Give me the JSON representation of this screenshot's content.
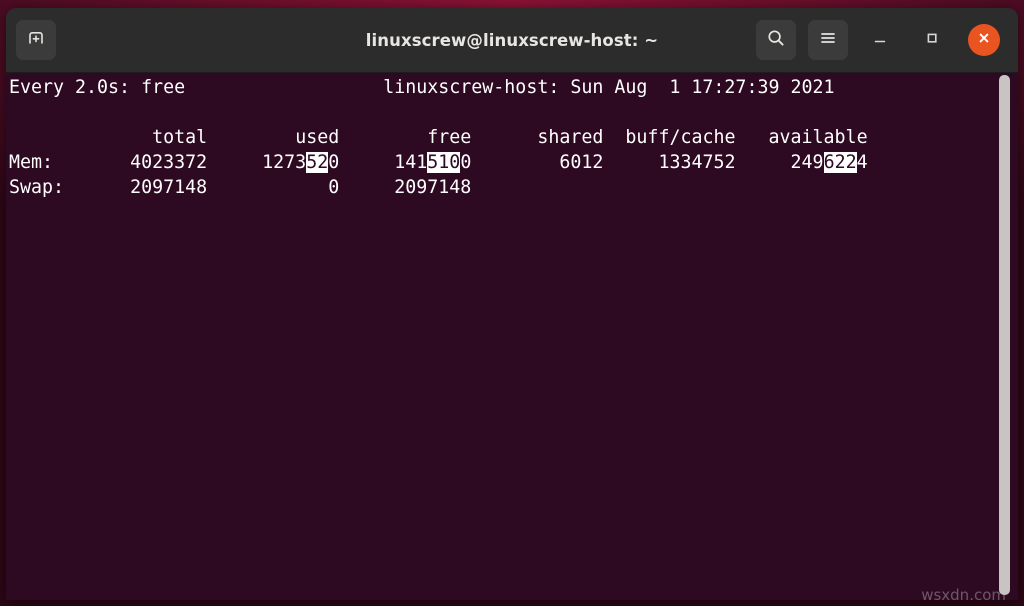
{
  "window": {
    "title": "linuxscrew@linuxscrew-host: ~",
    "new_tab_icon": "new-tab-icon",
    "search_icon": "search-icon",
    "menu_icon": "hamburger-menu-icon",
    "minimize_icon": "minimize-icon",
    "maximize_icon": "maximize-icon",
    "close_icon": "close-icon",
    "colors": {
      "titlebar_bg": "#2c2c2c",
      "terminal_bg": "#2d0922",
      "close_button": "#e95420",
      "text": "#ffffff",
      "scrollbar": "#c8c4c2",
      "desktop": "#6b0f2c"
    }
  },
  "terminal": {
    "watch_header_left": "Every 2.0s: free",
    "watch_header_right": "linuxscrew-host: Sun Aug  1 17:27:39 2021",
    "blank_line": "",
    "columns": [
      "total",
      "used",
      "free",
      "shared",
      "buff/cache",
      "available"
    ],
    "column_header_line": "              total        used        free      shared  buff/cache   available",
    "rows": [
      {
        "label": "Mem:",
        "total": "4023372",
        "used": "1273520",
        "used_plain_prefix": "1273",
        "used_highlight": "52",
        "used_plain_suffix": "0",
        "free": "1415100",
        "free_plain_prefix": "141",
        "free_highlight": "510",
        "free_plain_suffix": "0",
        "shared": "6012",
        "buff_cache": "1334752",
        "available": "2496224",
        "available_plain_prefix": "249",
        "available_highlight": "622",
        "available_plain_suffix": "4"
      },
      {
        "label": "Swap:",
        "total": "2097148",
        "used": "0",
        "free": "2097148",
        "shared": "",
        "buff_cache": "",
        "available": ""
      }
    ],
    "watermark": "wsxdn.com"
  }
}
